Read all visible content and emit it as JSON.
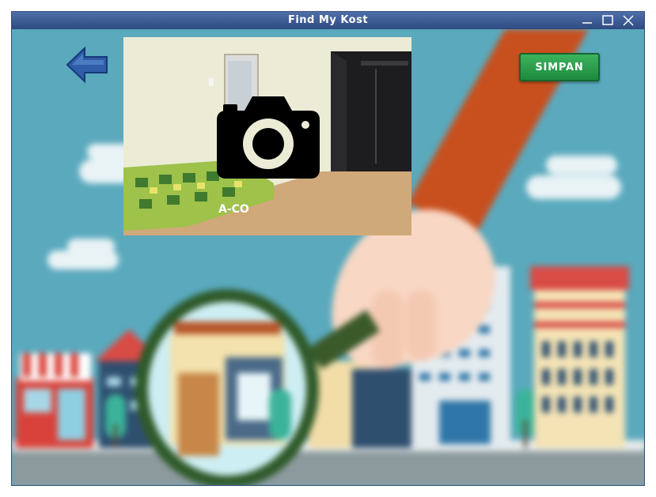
{
  "window": {
    "title": "Find My Kost",
    "controls": {
      "minimize_icon": "minimize-icon",
      "maximize_icon": "maximize-icon",
      "close_icon": "close-icon"
    }
  },
  "toolbar": {
    "back_icon": "arrow-left-icon",
    "save_label": "SIMPAN"
  },
  "photo": {
    "upload_icon": "camera-icon",
    "bed_label": "A-CO"
  },
  "colors": {
    "titlebar": "#2f4b82",
    "save_button": "#1d8a3e",
    "back_arrow": "#2f5da8",
    "sky": "#5aa9bd"
  }
}
